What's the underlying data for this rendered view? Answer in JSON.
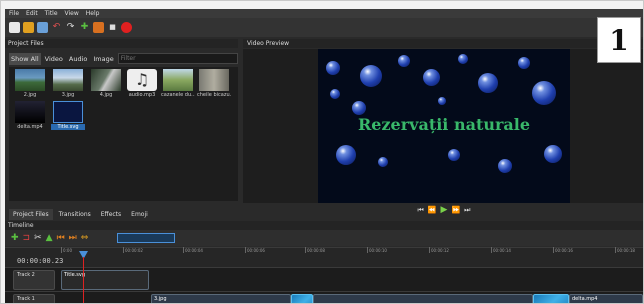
{
  "menu": [
    "File",
    "Edit",
    "Title",
    "View",
    "Help"
  ],
  "panels": {
    "project_files": "Project Files",
    "video_preview": "Video Preview",
    "timeline": "Timeline"
  },
  "filter": {
    "tabs": [
      "Show All",
      "Video",
      "Audio",
      "Image"
    ],
    "placeholder": "Filter"
  },
  "files": [
    {
      "name": "2.jpg"
    },
    {
      "name": "3.jpg"
    },
    {
      "name": "4.jpg"
    },
    {
      "name": "audio.mp3"
    },
    {
      "name": "cazanele du..."
    },
    {
      "name": "cheile bicazu..."
    },
    {
      "name": "delta.mp4"
    },
    {
      "name": "Title.svg"
    }
  ],
  "video": {
    "title": "Rezervații naturale"
  },
  "bottom_tabs": [
    "Project Files",
    "Transitions",
    "Effects",
    "Emoji"
  ],
  "timeline": {
    "timecode": "00:00:00.23",
    "tick_labels": [
      "0:00",
      "00:00:02",
      "00:00:04",
      "00:00:06",
      "00:00:08",
      "00:00:10",
      "00:00:12",
      "00:00:14",
      "00:00:16",
      "00:00:18"
    ],
    "tracks": [
      {
        "label": "Track 2",
        "clips": [
          {
            "label": "Title.svg"
          }
        ]
      },
      {
        "label": "Track 1",
        "clips": [
          {
            "label": "3.jpg"
          },
          {
            "label": "delta.mp4"
          }
        ]
      }
    ]
  },
  "badge": "1",
  "colors": {
    "title_green": "#39b86a",
    "accent_blue": "#4a90d9",
    "playhead_red": "#d22222"
  }
}
